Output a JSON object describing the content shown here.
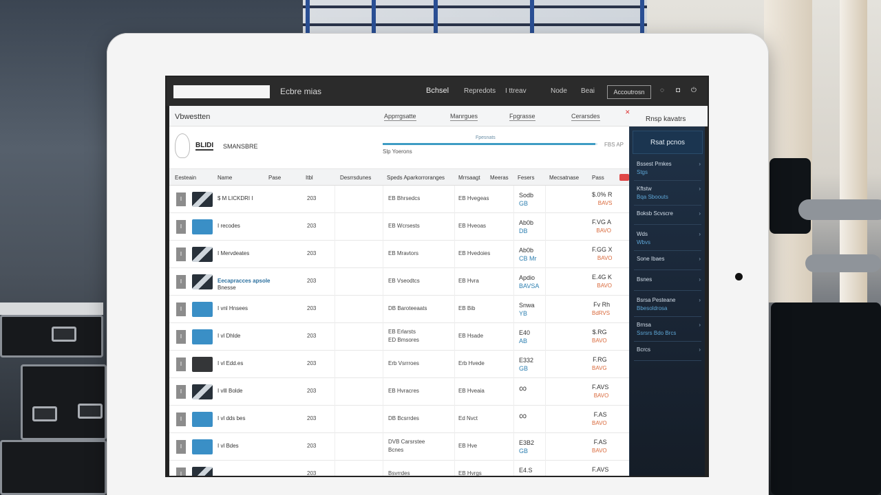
{
  "topbar": {
    "brand": "Ecbre mias",
    "nav": [
      "Bchsel",
      "Repredots",
      "I ttreav",
      "Node",
      "Beai"
    ],
    "account_button": "Accoutrosn",
    "icons": [
      "help-icon",
      "lock-icon",
      "power-icon"
    ]
  },
  "subbar": {
    "title": "Vbwestten",
    "tabs": [
      "Apprrgsatte",
      "Manrgues",
      "Fpgrasse",
      "Cerarsdes"
    ],
    "side_title": "Rnsp kavatrs"
  },
  "profile": {
    "id": "BLIDI",
    "name": "SMANSBRE",
    "progress_label": "Fpesnats",
    "progress_fraction": 0.99,
    "subtitle": "Slp Yoerons",
    "percent_text": "FBS AP"
  },
  "table": {
    "columns": [
      "Eesteain",
      "Name",
      "Pase",
      "Itbl",
      "Desrrsdunes",
      "Speds Aparkorroranges",
      "Mrrsaagt",
      "Meeras",
      "Fesers",
      "Mecsatnase",
      "Pass"
    ],
    "rows": [
      {
        "chk": "I",
        "thumb": "mixed",
        "name": "$ M LICKDRI I",
        "qty": "203",
        "desc": "EB Bhrsedcs",
        "code": "EB Hvegeas",
        "stat1": "Sodb",
        "stat2": "GB",
        "price1": "$.0% R",
        "price2": "BAVS"
      },
      {
        "chk": "I",
        "thumb": "blue",
        "name": "I recodes",
        "qty": "203",
        "desc": "EB Wcrsests",
        "code": "EB Hveoas",
        "stat1": "Ab0b",
        "stat2": "DB",
        "price1": "F.VG A",
        "price2": "BAVO"
      },
      {
        "chk": "I",
        "thumb": "mixed",
        "name": "I Mervdeates",
        "qty": "203",
        "desc": "EB Mravtors",
        "code": "EB Hvedoies",
        "stat1": "Ab0b",
        "stat2": "CB Mr",
        "price1": "F.GG X",
        "price2": "BAVO"
      },
      {
        "chk": "I",
        "thumb": "mixed",
        "name": "Eecapracces apsole",
        "name2": "Bnesse",
        "qty": "203",
        "desc": "EB Vseodtcs",
        "code": "EB Hvra",
        "stat1": "Apdio",
        "stat2": "BAVSA",
        "price1": "E.4G K",
        "price2": "BAVO"
      },
      {
        "chk": "I",
        "thumb": "blue",
        "name": "I vnl Hnsees",
        "qty": "203",
        "desc": "DB Baroteeaats",
        "code": "EB Bib",
        "stat1": "Snwa",
        "stat2": "YB",
        "price1": "Fv Rh",
        "price2": "BdRVS"
      },
      {
        "chk": "I",
        "thumb": "blue",
        "name": "I vl Dhlde",
        "qty": "203",
        "desc": "EB Erlarsts",
        "desc2": "ED Bmsores",
        "code": "EB Hsade",
        "stat1": "E40",
        "stat2": "AB",
        "price1": "$.RG",
        "price2": "BAVO"
      },
      {
        "chk": "I",
        "thumb": "dark",
        "name": "I vl Edd.es",
        "qty": "203",
        "desc": "Erb Vsrrroes",
        "code": "Erb Hvede",
        "stat1": "E332",
        "stat2": "GB",
        "price1": "F.RG",
        "price2": "BAVG"
      },
      {
        "chk": "I",
        "thumb": "mixed",
        "name": "I vlll Bolde",
        "qty": "203",
        "desc": "EB Hvracres",
        "code": "EB Hveaia",
        "stat1": "swirl",
        "stat2": "",
        "price1": "F.AVS",
        "price2": "BAVO"
      },
      {
        "chk": "I",
        "thumb": "blue",
        "name": "I vl dds bes",
        "qty": "203",
        "desc": "DB Bcsrrdes",
        "code": "Ed Nvct",
        "stat1": "swirl",
        "stat2": "",
        "price1": "F.AS",
        "price2": "BAVO"
      },
      {
        "chk": "I",
        "thumb": "blue",
        "name": "I vl Bdes",
        "qty": "203",
        "desc": "DVB Carsrstee",
        "desc2": "Bcnes",
        "code": "EB Hve",
        "stat1": "E3B2",
        "stat2": "GB",
        "price1": "F.AS",
        "price2": "BAVO"
      },
      {
        "chk": "I",
        "thumb": "mixed",
        "name": "",
        "qty": "203",
        "desc": "Bsvrrdes",
        "code": "EB Hvrgs",
        "stat1": "E4.S",
        "stat2": "",
        "price1": "F.AVS",
        "price2": ""
      }
    ]
  },
  "side_panel": {
    "header": "Rsat pcnos",
    "items": [
      {
        "label": "Bssest Pmkes",
        "sub": "Stgs"
      },
      {
        "label": "Kftstw",
        "sub": "Bqa Sboouts"
      },
      {
        "label": "Boksb Scvscre",
        "sub": ""
      },
      {
        "label": "Wds",
        "sub": "Wbvs"
      },
      {
        "label": "Sone Ibaes",
        "sub": ""
      },
      {
        "label": "Bsnes",
        "sub": ""
      },
      {
        "label": "Bsrsa Pesteane",
        "sub": "Bbesoldrosa"
      },
      {
        "label": "Brnsa",
        "sub": "Ssrsrs Bdo Brcs"
      },
      {
        "label": "Bcrcs",
        "sub": ""
      }
    ]
  },
  "colors": {
    "topbar": "#2b2b2b",
    "accent": "#3a8fc6",
    "side_panel": "#1f3248",
    "price_accent": "#d9683a"
  }
}
